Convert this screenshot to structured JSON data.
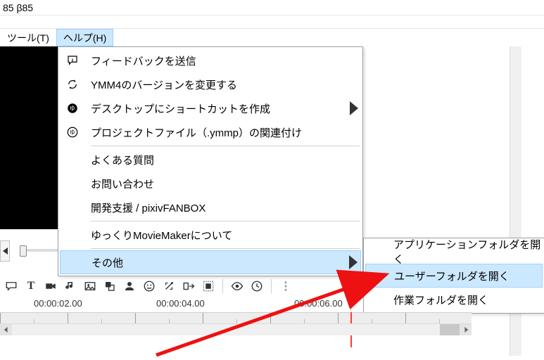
{
  "title_fragment": "85 β85",
  "menubar": {
    "tools": "ツール(T)",
    "help": "ヘルプ(H)"
  },
  "help_menu": {
    "feedback": "フィードバックを送信",
    "change_version": "YMM4のバージョンを変更する",
    "create_shortcut": "デスクトップにショートカットを作成",
    "assoc_ymmp": "プロジェクトファイル（.ymmp）の関連付け",
    "faq": "よくある質問",
    "contact": "お問い合わせ",
    "fanbox": "開発支援 / pixivFANBOX",
    "about": "ゆっくりMovieMakerについて",
    "other": "その他"
  },
  "other_submenu": {
    "app_folder": "アプリケーションフォルダを開く",
    "user_folder": "ユーザーフォルダを開く",
    "work_folder": "作業フォルダを開く"
  },
  "timeline": {
    "t1": "00:00:02.00",
    "t2": "00:00:04.00",
    "t3": "00:00:06.00"
  }
}
